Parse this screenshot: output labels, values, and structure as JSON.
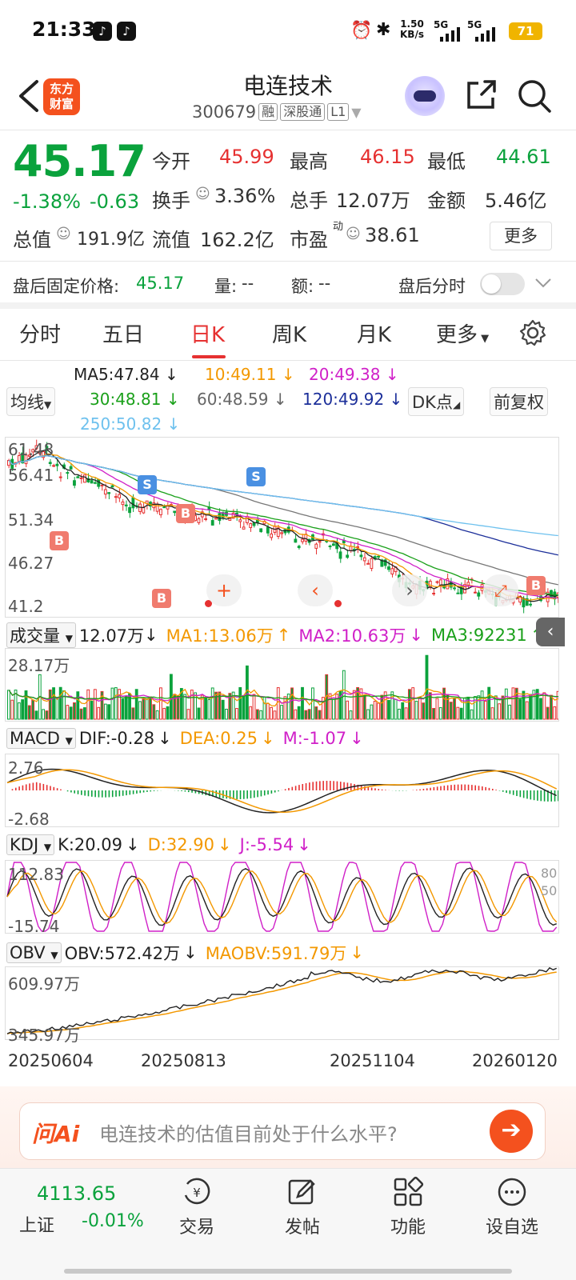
{
  "status_bar": {
    "time": "21:33",
    "net_speed": "1.50",
    "net_unit": "KB/s",
    "sig1": "5G",
    "sig2": "5G",
    "battery": "71"
  },
  "header": {
    "title": "电连技术",
    "code": "300679",
    "tags": [
      "融",
      "深股通",
      "L1"
    ],
    "logo_text_1": "东方",
    "logo_text_2": "财富"
  },
  "quote": {
    "price": "45.17",
    "change_pct": "-1.38%",
    "change": "-0.63",
    "open_label": "今开",
    "open": "45.99",
    "high_label": "最高",
    "high": "46.15",
    "low_label": "最低",
    "low": "44.61",
    "turnover_label": "换手",
    "turnover": "3.36%",
    "volume_label": "总手",
    "volume": "12.07万",
    "amount_label": "金额",
    "amount": "5.46亿",
    "mktcap_label": "总值",
    "mktcap": "191.9亿",
    "float_label": "流值",
    "float": "162.2亿",
    "pe_label": "市盈",
    "pe_sup": "动",
    "pe": "38.61",
    "more_label": "更多"
  },
  "after_hours": {
    "price_label": "盘后固定价格:",
    "price": "45.17",
    "vol_label": "量:",
    "vol": "--",
    "amt_label": "额:",
    "amt": "--",
    "toggle_label": "盘后分时"
  },
  "tabs": [
    "分时",
    "五日",
    "日K",
    "周K",
    "月K",
    "更多"
  ],
  "active_tab": "日K",
  "ma": {
    "ma5": "MA5:47.84",
    "ma10": "10:49.11",
    "ma20": "20:49.38",
    "ma30": "30:48.81",
    "ma60": "60:48.59",
    "ma120": "120:49.92",
    "ma250": "250:50.82",
    "select_label": "均线",
    "dk_label": "DK点",
    "fq_label": "前复权",
    "arrow": "↓"
  },
  "kline": {
    "y_labels": [
      "61.48",
      "56.41",
      "51.34",
      "46.27",
      "41.2"
    ],
    "markers": [
      "B",
      "S",
      "B",
      "S",
      "B",
      "B"
    ]
  },
  "volume": {
    "select": "成交量",
    "value": "12.07万",
    "ma1": "MA1:13.06万",
    "ma2": "MA2:10.63万",
    "ma3": "MA3:92231",
    "ymax": "28.17万",
    "up": "↑",
    "down": "↓"
  },
  "macd": {
    "select": "MACD",
    "dif": "DIF:-0.28",
    "dea": "DEA:0.25",
    "m": "M:-1.07",
    "ymax": "2.76",
    "ymin": "-2.68"
  },
  "kdj": {
    "select": "KDJ",
    "k": "K:20.09",
    "d": "D:32.90",
    "j": "J:-5.54",
    "ymax": "112.83",
    "ymin": "-15.74",
    "r80": "80",
    "r50": "50"
  },
  "obv": {
    "select": "OBV",
    "obv": "OBV:572.42万",
    "maobv": "MAOBV:591.79万",
    "ymax": "609.97万",
    "ymin": "345.97万"
  },
  "dates": [
    "20250604",
    "20250813",
    "20251104",
    "20260120"
  ],
  "ai": {
    "brand": "问Ai",
    "prompt": "电连技术的估值目前处于什么水平?"
  },
  "bottom_nav": {
    "index_value": "4113.65",
    "index_name": "上证",
    "index_change": "-0.01%",
    "items": [
      "交易",
      "发帖",
      "功能",
      "设自选"
    ]
  },
  "colors": {
    "up": "#e63131",
    "down": "#0aa23c",
    "accent": "#f4511e",
    "ma5": "#222222",
    "ma10": "#f39800",
    "ma20": "#d020c8",
    "ma30": "#1aa01a",
    "ma60": "#777777",
    "ma120": "#1c2f9a",
    "ma250": "#6ec1ee"
  }
}
